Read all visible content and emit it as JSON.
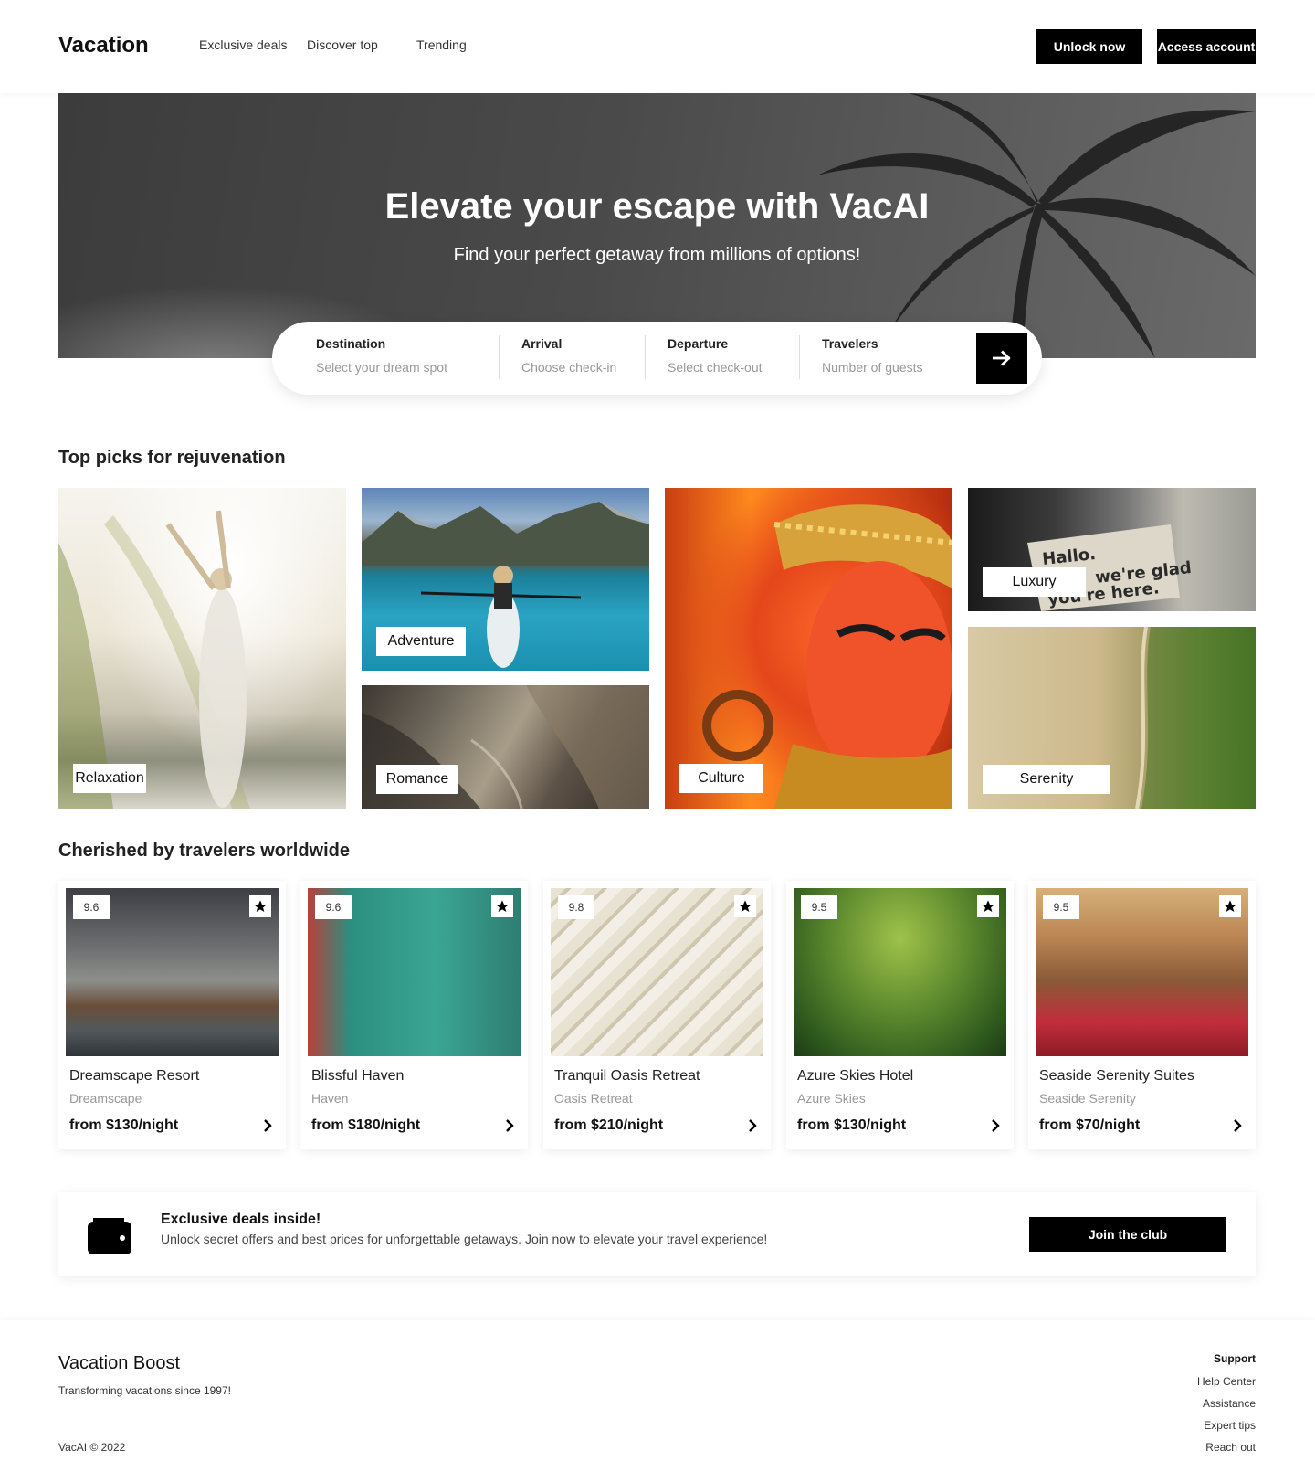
{
  "header": {
    "logo": "Vacation",
    "nav": [
      "Exclusive deals",
      "Discover top",
      "Trending"
    ],
    "unlock_label": "Unlock now",
    "account_label": "Access account"
  },
  "hero": {
    "title": "Elevate your escape with VacAI",
    "subtitle": "Find your perfect getaway from millions of options!"
  },
  "search": {
    "destination": {
      "label": "Destination",
      "placeholder": "Select your dream spot"
    },
    "arrival": {
      "label": "Arrival",
      "placeholder": "Choose check-in"
    },
    "departure": {
      "label": "Departure",
      "placeholder": "Select check-out"
    },
    "travelers": {
      "label": "Travelers",
      "placeholder": "Number of guests"
    },
    "submit_icon": "arrow-right-icon"
  },
  "top_picks": {
    "title": "Top picks for rejuvenation",
    "tiles": [
      "Relaxation",
      "Adventure",
      "Romance",
      "Culture",
      "Luxury",
      "Serenity"
    ]
  },
  "hotels": {
    "title": "Cherished by travelers worldwide",
    "items": [
      {
        "score": "9.6",
        "name": "Dreamscape Resort",
        "sub": "Dreamscape",
        "price": "from $130/night"
      },
      {
        "score": "9.6",
        "name": "Blissful Haven",
        "sub": "Haven",
        "price": "from $180/night"
      },
      {
        "score": "9.8",
        "name": "Tranquil Oasis Retreat",
        "sub": "Oasis Retreat",
        "price": "from $210/night"
      },
      {
        "score": "9.5",
        "name": "Azure Skies Hotel",
        "sub": "Azure Skies",
        "price": "from $130/night"
      },
      {
        "score": "9.5",
        "name": "Seaside Serenity Suites",
        "sub": "Seaside Serenity",
        "price": "from $70/night"
      }
    ]
  },
  "deals": {
    "title": "Exclusive deals inside!",
    "text": "Unlock secret offers and best prices for unforgettable getaways. Join now to elevate your travel experience!",
    "button": "Join the club",
    "icon": "wallet-icon"
  },
  "footer": {
    "brand": "Vacation Boost",
    "tagline": "Transforming vacations since 1997!",
    "copyright": "VacAI © 2022",
    "support_heading": "Support",
    "links": [
      "Help Center",
      "Assistance",
      "Expert tips",
      "Reach out"
    ]
  },
  "colors": {
    "accent": "#000000",
    "background": "#ffffff",
    "muted_text": "#999999"
  },
  "tile_signage": {
    "luxury_sign": "Hallo. we're glad you're here."
  }
}
